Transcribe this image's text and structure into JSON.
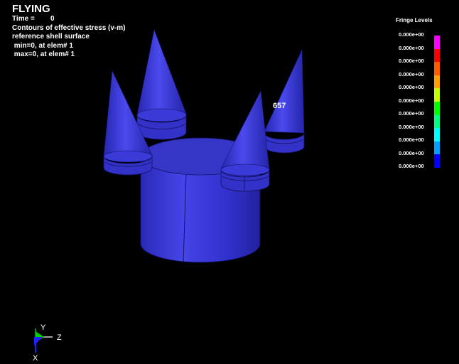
{
  "header": {
    "title": "FLYING",
    "time_line": "Time =        0",
    "lines": [
      "Contours of effective stress (v-m)",
      "reference shell surface",
      " min=0, at elem# 1",
      " max=0, at elem# 1"
    ]
  },
  "legend": {
    "title": "Fringe Levels",
    "levels": [
      "0.000e+00",
      "0.000e+00",
      "0.000e+00",
      "0.000e+00",
      "0.000e+00",
      "0.000e+00",
      "0.000e+00",
      "0.000e+00",
      "0.000e+00",
      "0.000e+00",
      "0.000e+00"
    ],
    "colors": [
      "#ff00ff",
      "#ff0000",
      "#ff5a00",
      "#ffa000",
      "#c8ff00",
      "#00ff00",
      "#00ff80",
      "#00ffff",
      "#00a0ff",
      "#0000ff"
    ]
  },
  "scene": {
    "element_label": "657",
    "model_color": "#3434d8"
  },
  "triad": {
    "y": "Y",
    "z": "Z",
    "x": "X"
  }
}
